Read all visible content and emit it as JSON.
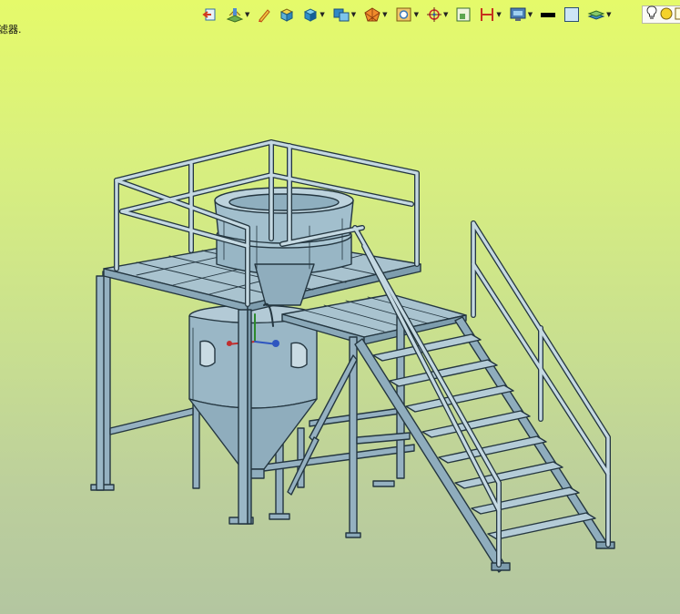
{
  "status": {
    "hint_text": "滤器."
  },
  "toolbar": {
    "icons": [
      "exit-sketch-icon",
      "section-view-icon",
      "pen-icon",
      "box-view-icon",
      "shaded-view-icon",
      "display-mode-icon",
      "render-icon",
      "view-orientation-icon",
      "target-icon",
      "frame-icon",
      "dimension-icon",
      "monitor-icon",
      "line-color-swatch",
      "background-swatch",
      "layers-icon",
      "lightbulb-icon",
      "color-ball-icon"
    ]
  },
  "colors": {
    "background_top": "#e5fa6a",
    "background_bottom": "#b3c6a0",
    "model_fill": "#9ab7c6",
    "model_edge": "#243640",
    "rail_fill": "#c5d9e2"
  }
}
